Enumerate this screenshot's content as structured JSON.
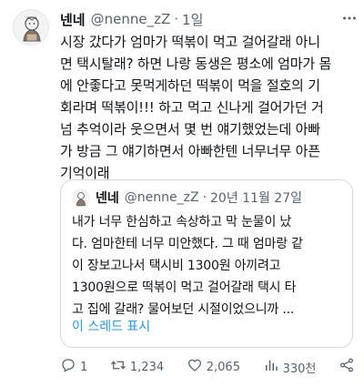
{
  "tweet": {
    "name": "넨네",
    "handle": "@nenne_zZ",
    "separator": "·",
    "time": "1일",
    "text": "시장 갔다가 엄마가 떡볶이 먹고 걸어갈래 아니\n면 택시탈래? 하면 나랑 동생은 평소에 엄마가 몸\n에 안좋다고 못먹게하던 떡볶이 먹을 절호의 기\n회라며 떡볶이!!! 하고 먹고 신나게 걸어가던 거\n넘 추억이라 웃으면서 몇 번 얘기했었는데 아빠\n가 방금 그 얘기하면서 아빠한텐 너무너무 아픈\n기억이래"
  },
  "quote": {
    "name": "넨네",
    "handle": "@nenne_zZ",
    "separator": "·",
    "time": "20년 11월 27일",
    "text": "내가 너무 한심하고 속상하고 막 눈물이 났\n다. 엄마한테 너무 미안했다. 그 때 엄마랑 같\n이 장보고나서 택시비 1300원 아끼려고\n1300원으로 떡볶이 먹고 걸어갈래 택시 타\n고 집에 갈래? 물어보던 시절이었으니까 ...",
    "show_thread": "이 스레드 표시"
  },
  "actions": {
    "replies": "1",
    "retweets": "1,234",
    "likes": "2,065",
    "views": "330천"
  },
  "colors": {
    "text": "#0f1419",
    "secondary": "#536471",
    "link": "#1d9bf0",
    "border": "#cfd9de"
  }
}
